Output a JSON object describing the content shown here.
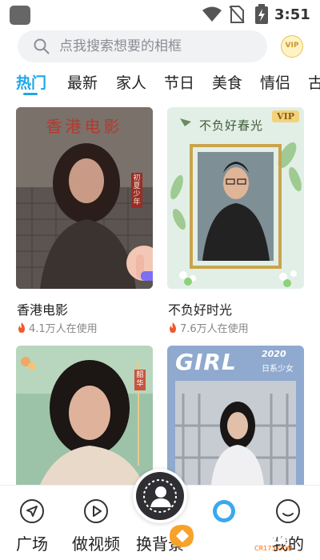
{
  "status_bar": {
    "time": "3:51"
  },
  "search": {
    "placeholder": "点我搜索想要的相框",
    "vip_label": "VIP"
  },
  "tabs": [
    {
      "label": "热门"
    },
    {
      "label": "最新"
    },
    {
      "label": "家人"
    },
    {
      "label": "节日"
    },
    {
      "label": "美食"
    },
    {
      "label": "情侣"
    },
    {
      "label": "古"
    }
  ],
  "cards": [
    {
      "title": "香港电影",
      "usage": "4.1万人在使用",
      "overlay_text": "香港电影",
      "side_text": "初夏少年"
    },
    {
      "title": "不负好时光",
      "usage": "7.6万人在使用",
      "overlay_text": "不负好春光",
      "vip_tag": "VIP"
    },
    {
      "title": "",
      "usage": "",
      "side_text": "韶华"
    },
    {
      "title": "",
      "usage": "",
      "overlay_title": "GIRL",
      "overlay_year": "2020",
      "overlay_sub": "日系少女"
    }
  ],
  "bottom_nav": [
    {
      "label": "广场",
      "icon": "navigation-arrow-icon"
    },
    {
      "label": "做视频",
      "icon": "play-icon"
    },
    {
      "label": "换背景",
      "icon": "portrait-icon"
    },
    {
      "label": "",
      "icon": "circle-icon"
    },
    {
      "label": "我的",
      "icon": "smile-icon"
    }
  ],
  "watermark": {
    "text": "西西软件园",
    "domain": "CR173.COM"
  },
  "colors": {
    "accent": "#1da7e8",
    "fire": "#ef5a2c",
    "vip_gold": "#f3d27c"
  }
}
